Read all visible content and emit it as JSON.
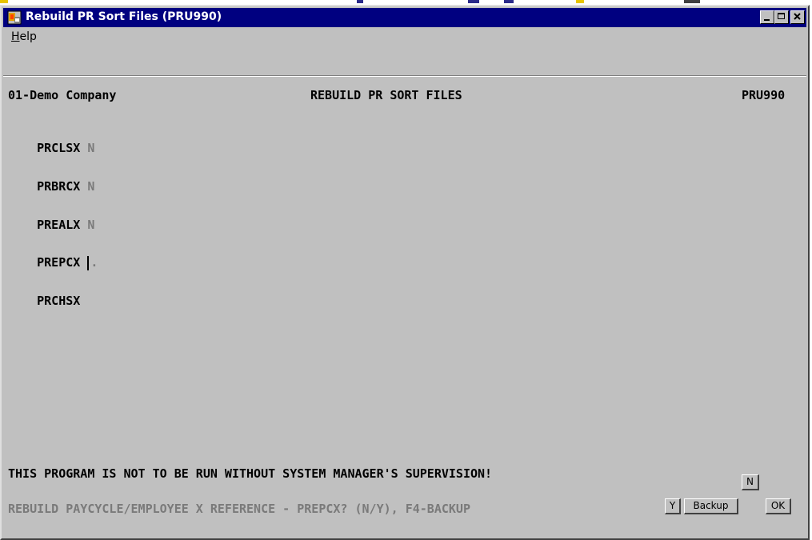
{
  "window": {
    "title": "Rebuild PR Sort Files (PRU990)",
    "icon": "app-icon"
  },
  "menu": {
    "help_label": "Help"
  },
  "header": {
    "company": "01-Demo Company",
    "screen_title": "REBUILD PR SORT FILES",
    "program_code": "PRU990"
  },
  "fields": [
    {
      "label": "PRCLSX",
      "value": "N"
    },
    {
      "label": "PRBRCX",
      "value": "N"
    },
    {
      "label": "PREALX",
      "value": "N"
    },
    {
      "label": "PREPCX",
      "value": "."
    },
    {
      "label": "PRCHSX",
      "value": ""
    }
  ],
  "messages": {
    "warning": "THIS PROGRAM IS NOT TO BE RUN WITHOUT SYSTEM MANAGER'S SUPERVISION!",
    "prompt": "REBUILD PAYCYCLE/EMPLOYEE X REFERENCE - PREPCX? (N/Y), F4-BACKUP"
  },
  "buttons": {
    "n": "N",
    "y": "Y",
    "backup": "Backup",
    "ok": "OK"
  },
  "colors": {
    "titlebar": "#000080",
    "window_bg": "#c0c0c0",
    "dim_text": "#7a7a7a"
  }
}
